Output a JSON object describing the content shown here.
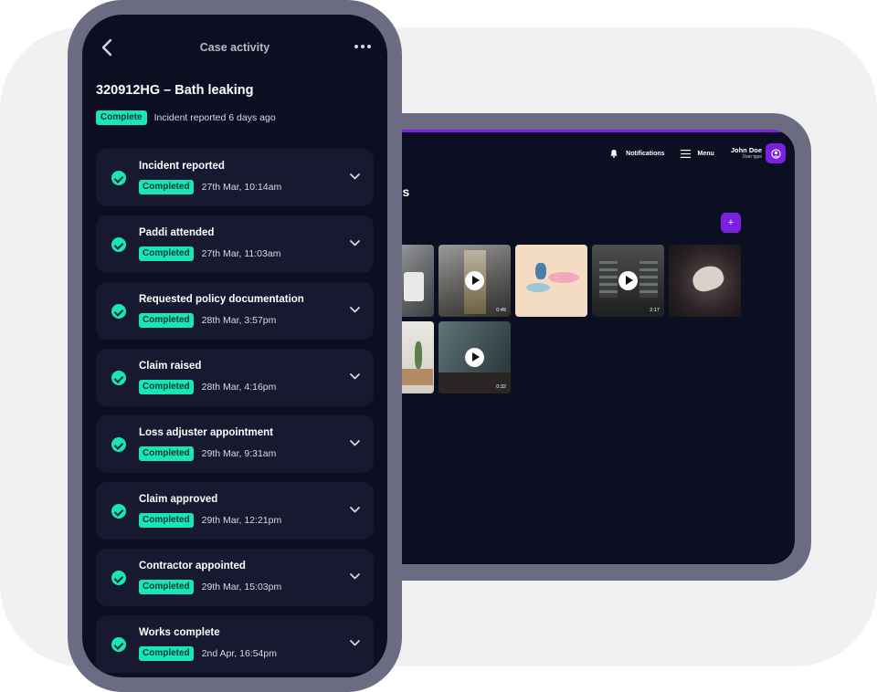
{
  "tablet": {
    "header": {
      "notifications_label": "Notifications",
      "menu_label": "Menu",
      "user_name": "John Doe",
      "user_type": "User type"
    },
    "page_title_fragment": "os",
    "add_label": "+",
    "media": [
      {
        "kind": "image",
        "duration": ""
      },
      {
        "kind": "video",
        "duration": "0:49"
      },
      {
        "kind": "image",
        "duration": ""
      },
      {
        "kind": "video",
        "duration": "2:17"
      },
      {
        "kind": "image",
        "duration": ""
      },
      {
        "kind": "image",
        "duration": ""
      },
      {
        "kind": "video",
        "duration": "0:32"
      }
    ]
  },
  "phone": {
    "nav_title": "Case activity",
    "case_title": "320912HG – Bath leaking",
    "case_status": "Complete",
    "case_status_text": "Incident reported 6 days ago",
    "activities": [
      {
        "title": "Incident reported",
        "status": "Completed",
        "date": "27th Mar, 10:14am"
      },
      {
        "title": "Paddi attended",
        "status": "Completed",
        "date": "27th Mar, 11:03am"
      },
      {
        "title": "Requested policy documentation",
        "status": "Completed",
        "date": "28th Mar, 3:57pm"
      },
      {
        "title": "Claim raised",
        "status": "Completed",
        "date": "28th Mar, 4:16pm"
      },
      {
        "title": "Loss adjuster appointment",
        "status": "Completed",
        "date": "29th Mar, 9:31am"
      },
      {
        "title": "Claim approved",
        "status": "Completed",
        "date": "29th Mar, 12:21pm"
      },
      {
        "title": "Contractor appointed",
        "status": "Completed",
        "date": "29th Mar, 15:03pm"
      },
      {
        "title": "Works complete",
        "status": "Completed",
        "date": "2nd Apr, 16:54pm"
      }
    ]
  },
  "colors": {
    "accent_purple": "#7b1fe0",
    "success_green": "#19e6b4",
    "screen_bg": "#0c0f22",
    "card_bg": "#16192f",
    "device_frame": "#6b6c82"
  }
}
